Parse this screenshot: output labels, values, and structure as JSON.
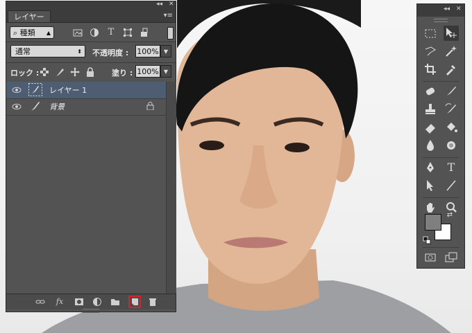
{
  "layers_panel": {
    "tab_title": "レイヤー",
    "collapse_glyph": "◂◂",
    "close_glyph": "✕",
    "menu_glyph": "▾≡",
    "filter": {
      "search_glyph": "⌕",
      "kind_label": "種類"
    },
    "filter_icons": [
      "image-filter-icon",
      "adjustment-filter-icon",
      "type-filter-icon",
      "shape-filter-icon",
      "smart-object-filter-icon"
    ],
    "blend_mode": "通常",
    "opacity_label": "不透明度 :",
    "opacity_value": "100%",
    "lock_label": "ロック :",
    "fill_label": "塗り :",
    "fill_value": "100%",
    "layers": [
      {
        "name": "レイヤー 1",
        "selected": true,
        "visible": true,
        "locked": false
      },
      {
        "name": "背景",
        "selected": false,
        "visible": true,
        "locked": true
      }
    ],
    "bottom_icons": [
      "link-layers-icon",
      "layer-style-icon",
      "layer-mask-icon",
      "adjustment-layer-icon",
      "group-folder-icon",
      "new-layer-icon",
      "delete-layer-icon"
    ],
    "highlight_color": "#d0262b",
    "selected_row_color": "#4f5d72",
    "fx_label": "fx"
  },
  "tools_panel": {
    "collapse_glyph": "◂◂",
    "close_glyph": "✕",
    "tools": [
      "marquee-tool-icon",
      "move-tool-icon",
      "lasso-tool-icon",
      "magic-wand-tool-icon",
      "crop-tool-icon",
      "eyedropper-tool-icon",
      "spot-healing-tool-icon",
      "brush-tool-icon",
      "clone-stamp-tool-icon",
      "history-brush-tool-icon",
      "eraser-tool-icon",
      "paint-bucket-tool-icon",
      "blur-tool-icon",
      "dodge-tool-icon",
      "pen-tool-icon",
      "type-tool-icon",
      "path-selection-tool-icon",
      "line-tool-icon",
      "hand-tool-icon",
      "zoom-tool-icon",
      "quick-mask-icon",
      "screen-mode-icon"
    ],
    "type_glyph": "T",
    "foreground_color": "#7f7f7f",
    "background_color": "#ffffff"
  }
}
